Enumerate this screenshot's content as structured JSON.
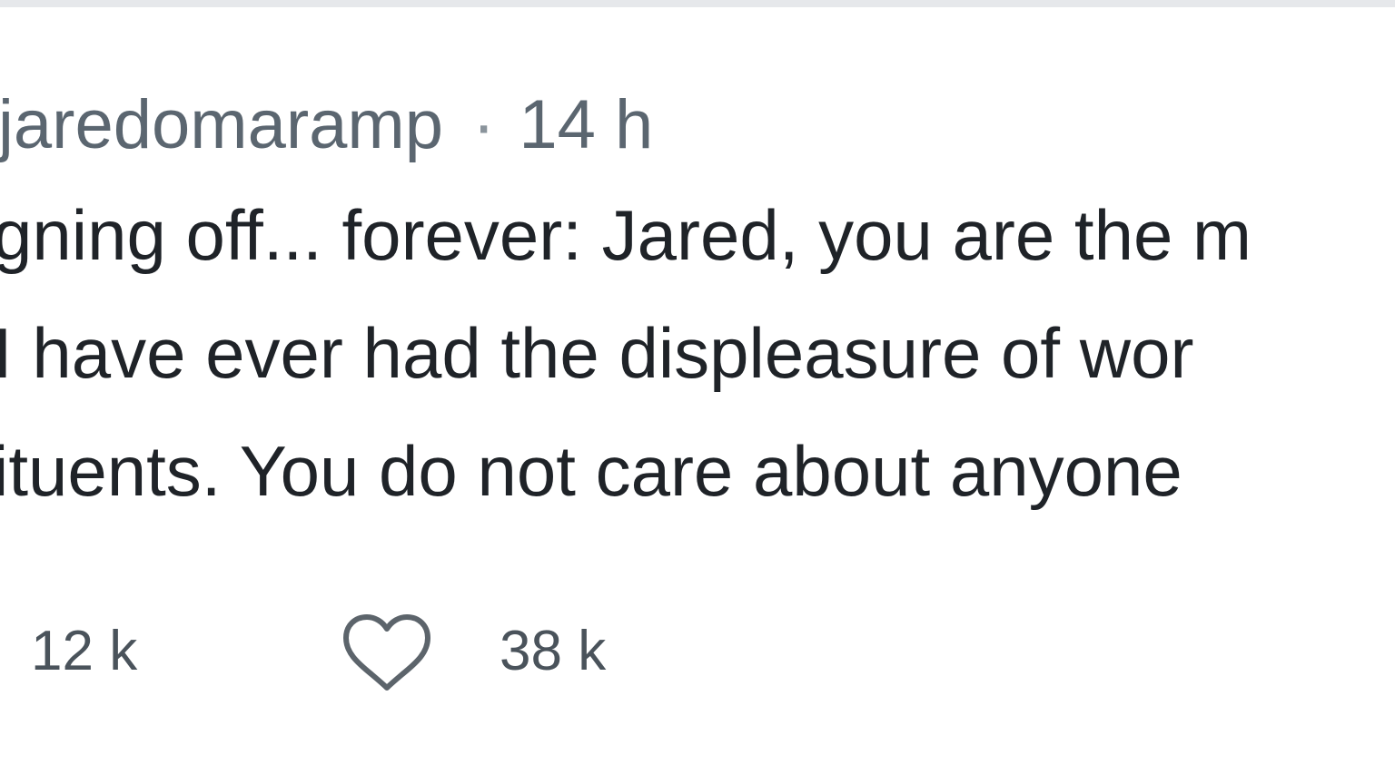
{
  "tweet": {
    "handle": "jaredomaramp",
    "separator": "·",
    "timestamp": "14 h",
    "body_lines": [
      "gning off... forever: Jared, you are the m",
      "I have ever had the displeasure of wor",
      "ituents. You do not care about anyone"
    ]
  },
  "actions": {
    "retweet_count": "12 k",
    "like_count": "38 k",
    "like_icon": "heart-icon"
  },
  "colors": {
    "divider": "#e6e8eb",
    "text": "#1f2328",
    "muted": "#5b6670",
    "icon": "#5c646b"
  }
}
